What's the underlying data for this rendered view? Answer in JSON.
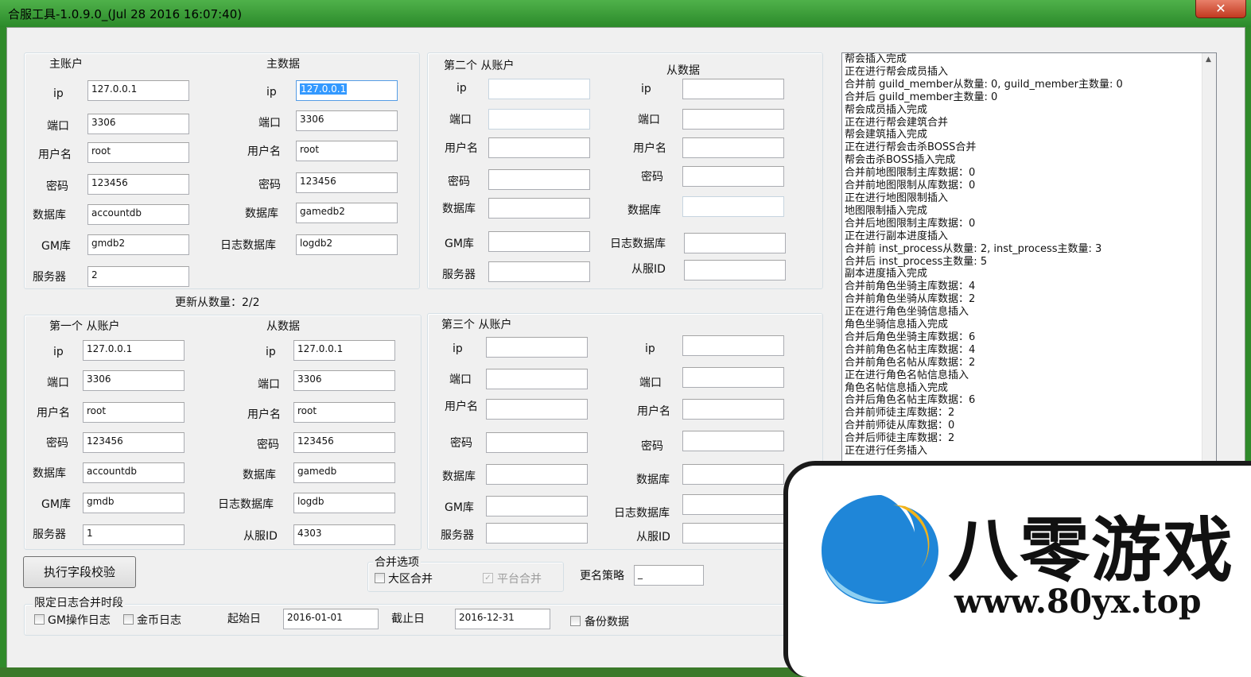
{
  "window": {
    "title": "合服工具-1.0.9.0_(Jul 28 2016  16:07:40)",
    "close_glyph": "✕"
  },
  "common_labels": {
    "ip": "ip",
    "port": "端口",
    "user": "用户名",
    "password": "密码",
    "database": "数据库",
    "gm_db": "GM库",
    "server": "服务器",
    "log_db": "日志数据库",
    "slave_id": "从服ID"
  },
  "main": {
    "account_title": "主账户",
    "data_title": "主数据",
    "account": {
      "ip": "127.0.0.1",
      "port": "3306",
      "user": "root",
      "password": "123456",
      "database": "accountdb",
      "gm_db": "gmdb2",
      "server": "2"
    },
    "data": {
      "ip": "127.0.0.1",
      "port": "3306",
      "user": "root",
      "password": "123456",
      "database": "gamedb2",
      "log_db": "logdb2"
    }
  },
  "second": {
    "account_title": "第二个 从账户",
    "data_title": "从数据",
    "account": {
      "ip": "",
      "port": "",
      "user": "",
      "password": "",
      "database": "",
      "gm_db": "",
      "server": ""
    },
    "data": {
      "ip": "",
      "port": "",
      "user": "",
      "password": "",
      "database": "",
      "log_db": "",
      "slave_id": ""
    }
  },
  "update_count": "更新从数量：2/2",
  "first": {
    "account_title": "第一个 从账户",
    "data_title": "从数据",
    "account": {
      "ip": "127.0.0.1",
      "port": "3306",
      "user": "root",
      "password": "123456",
      "database": "accountdb",
      "gm_db": "gmdb",
      "server": "1"
    },
    "data": {
      "ip": "127.0.0.1",
      "port": "3306",
      "user": "root",
      "password": "123456",
      "database": "gamedb",
      "log_db": "logdb",
      "slave_id": "4303"
    }
  },
  "third": {
    "account_title": "第三个 从账户",
    "account": {
      "ip": "",
      "port": "",
      "user": "",
      "password": "",
      "database": "",
      "gm_db": "",
      "server": ""
    },
    "data": {
      "ip": "",
      "port": "",
      "user": "",
      "password": "",
      "database": "",
      "log_db": "",
      "slave_id": ""
    }
  },
  "actions": {
    "validate_button": "执行字段校验"
  },
  "merge_options": {
    "title": "合并选项",
    "zone_merge": {
      "label": "大区合并",
      "checked": false
    },
    "platform_merge": {
      "label": "平台合并",
      "checked": true,
      "disabled": true
    },
    "rename_label": "更名策略",
    "rename_value": "_"
  },
  "log_period": {
    "title": "限定日志合并时段",
    "gm_log": {
      "label": "GM操作日志",
      "checked": false
    },
    "gold_log": {
      "label": "金币日志",
      "checked": false
    },
    "start_label": "起始日",
    "start_value": "2016-01-01",
    "end_label": "截止日",
    "end_value": "2016-12-31",
    "backup": {
      "label": "备份数据",
      "checked": false
    }
  },
  "log_lines": [
    "帮会插入完成",
    "正在进行帮会成员插入",
    "合并前 guild_member从数量: 0, guild_member主数量: 0",
    "合并后 guild_member主数量: 0",
    "帮会成员插入完成",
    "正在进行帮会建筑合并",
    "帮会建筑插入完成",
    "正在进行帮会击杀BOSS合并",
    "帮会击杀BOSS插入完成",
    "合并前地图限制主库数据：0",
    "合并前地图限制从库数据：0",
    "正在进行地图限制插入",
    "地图限制插入完成",
    "合并后地图限制主库数据：0",
    "正在进行副本进度插入",
    "合并前 inst_process从数量: 2, inst_process主数量: 3",
    "合并后 inst_process主数量: 5",
    "副本进度插入完成",
    "合并前角色坐骑主库数据：4",
    "合并前角色坐骑从库数据：2",
    "正在进行角色坐骑信息插入",
    "角色坐骑信息插入完成",
    "合并后角色坐骑主库数据：6",
    "合并前角色名帖主库数据：4",
    "合并前角色名帖从库数据：2",
    "正在进行角色名帖信息插入",
    "角色名帖信息插入完成",
    "合并后角色名帖主库数据：6",
    "合并前师徒主库数据：2",
    "合并前师徒从库数据：0",
    "合并后师徒主库数据：2",
    "正在进行任务插入"
  ],
  "watermark": {
    "brand": "八零游戏",
    "url": "www.80yx.top"
  }
}
